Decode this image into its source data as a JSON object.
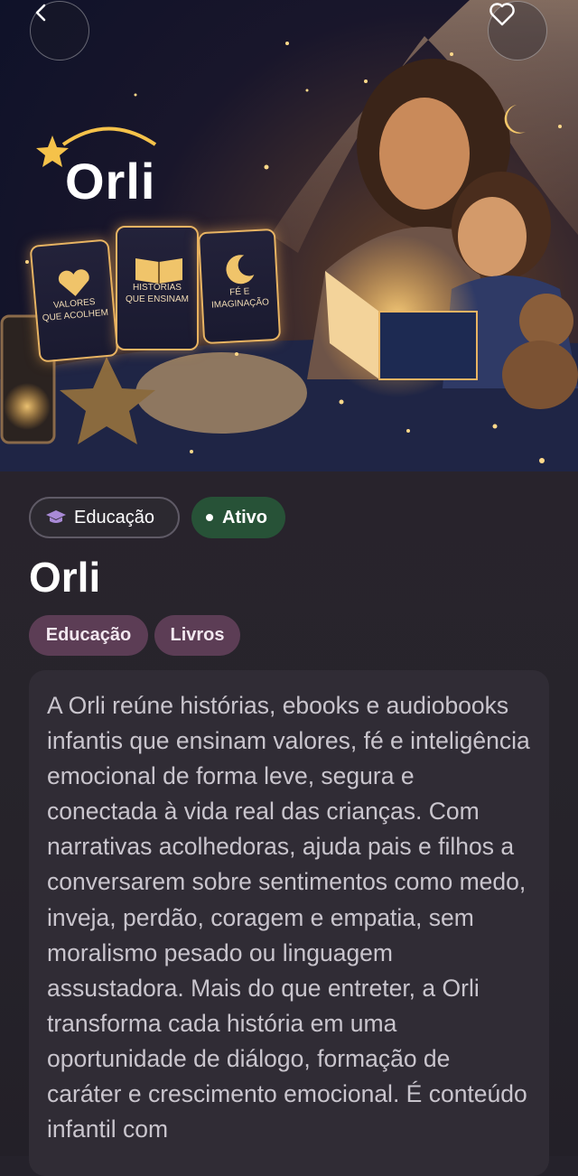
{
  "header": {
    "back_icon": "chevron-left-icon",
    "favorite_icon": "heart-outline-icon"
  },
  "hero": {
    "logo_text": "Orli",
    "cards": [
      {
        "line1": "VALORES",
        "line2": "QUE ACOLHEM",
        "icon": "heart-icon"
      },
      {
        "line1": "HISTÓRIAS",
        "line2": "QUE ENSINAM",
        "icon": "open-book-icon"
      },
      {
        "line1": "FÉ E",
        "line2": "IMAGINAÇÃO",
        "icon": "crescent-moon-icon"
      }
    ]
  },
  "badges": {
    "category": "Educação",
    "category_icon": "graduation-cap-icon",
    "status": "Ativo",
    "status_color": "#275237"
  },
  "title": "Orli",
  "tags": [
    "Educação",
    "Livros"
  ],
  "description": "A Orli reúne histórias, ebooks e audiobooks infantis que ensinam valores, fé e inteligência emocional de forma leve, segura e conectada à vida real das crianças. Com narrativas acolhedoras, ajuda pais e filhos a conversarem sobre sentimentos como medo, inveja, perdão, coragem e empatia, sem moralismo pesado ou linguagem assustadora. Mais do que entreter, a Orli transforma cada história em uma oportunidade de diálogo, formação de caráter e crescimento emocional. É conteúdo infantil com",
  "colors": {
    "background": "#25222b",
    "tag_bg": "#5c3d55",
    "accent_gold": "#e8b463"
  }
}
